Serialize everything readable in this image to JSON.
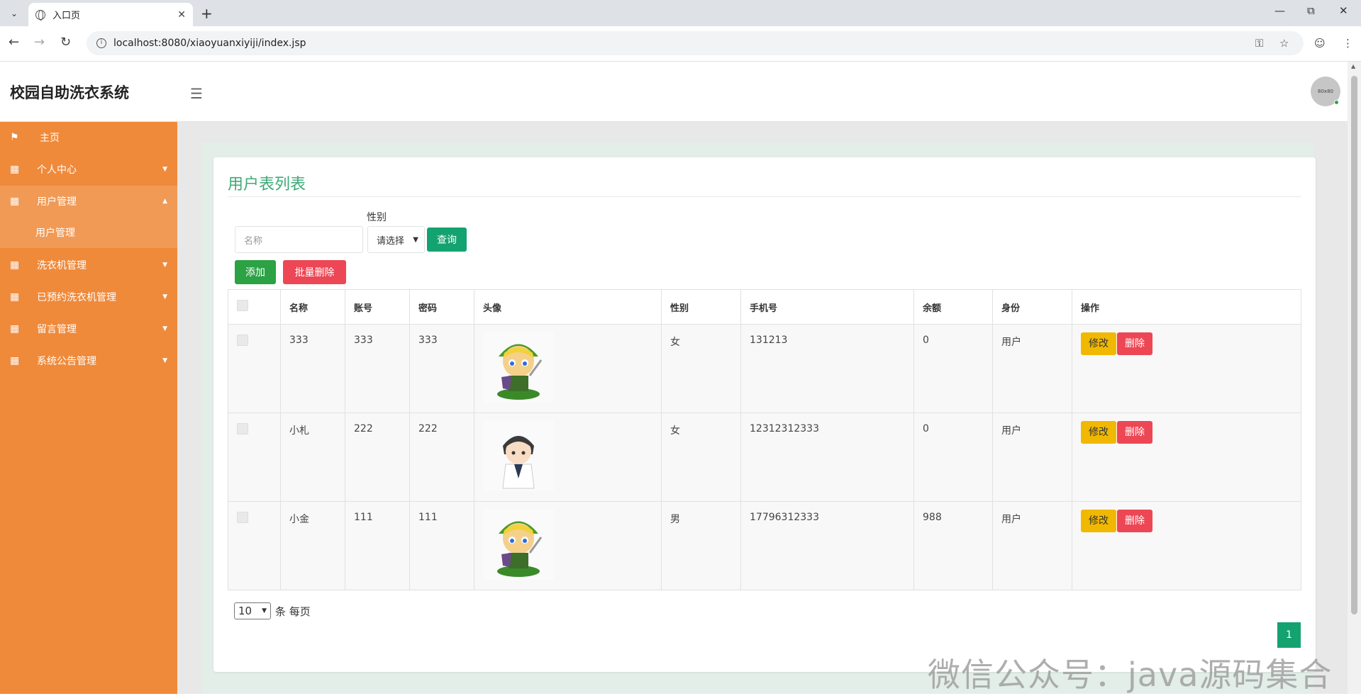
{
  "browser": {
    "tab_title": "入口页",
    "url": "localhost:8080/xiaoyuanxiyiji/index.jsp"
  },
  "app": {
    "title": "校园自助洗衣系统",
    "avatar_text": "80x80"
  },
  "sidebar": {
    "items": [
      {
        "label": "主页",
        "icon": "flag-icon"
      },
      {
        "label": "个人中心",
        "icon": "grid-icon"
      },
      {
        "label": "用户管理",
        "icon": "grid-icon"
      },
      {
        "label": "洗衣机管理",
        "icon": "grid-icon"
      },
      {
        "label": "已预约洗衣机管理",
        "icon": "grid-icon"
      },
      {
        "label": "留言管理",
        "icon": "grid-icon"
      },
      {
        "label": "系统公告管理",
        "icon": "grid-icon"
      }
    ],
    "subitem": "用户管理"
  },
  "main": {
    "title": "用户表列表",
    "filter": {
      "sex_label": "性别",
      "name_placeholder": "名称",
      "sex_select": "请选择",
      "query_button": "查询"
    },
    "add_button": "添加",
    "batch_delete_button": "批量删除",
    "table": {
      "headers": [
        "名称",
        "账号",
        "密码",
        "头像",
        "性别",
        "手机号",
        "余额",
        "身份",
        "操作"
      ],
      "rows": [
        {
          "name": "333",
          "account": "333",
          "password": "333",
          "avatar": "elf-avatar",
          "sex": "女",
          "phone": "131213",
          "balance": "0",
          "role": "用户"
        },
        {
          "name": "小札",
          "account": "222",
          "password": "222",
          "avatar": "doctor-avatar",
          "sex": "女",
          "phone": "12312312333",
          "balance": "0",
          "role": "用户"
        },
        {
          "name": "小金",
          "account": "111",
          "password": "111",
          "avatar": "elf-avatar",
          "sex": "男",
          "phone": "17796312333",
          "balance": "988",
          "role": "用户"
        }
      ],
      "edit_label": "修改",
      "delete_label": "删除"
    },
    "pager": {
      "page_size": "10",
      "per_page_label": "条 每页",
      "current_page": "1"
    }
  },
  "watermark": "微信公众号：java源码集合",
  "colors": {
    "sidebar": "#ef8a3b",
    "accent_green": "#13a270",
    "danger": "#ed4755",
    "warning": "#f0b800",
    "title_green": "#3daa77"
  }
}
